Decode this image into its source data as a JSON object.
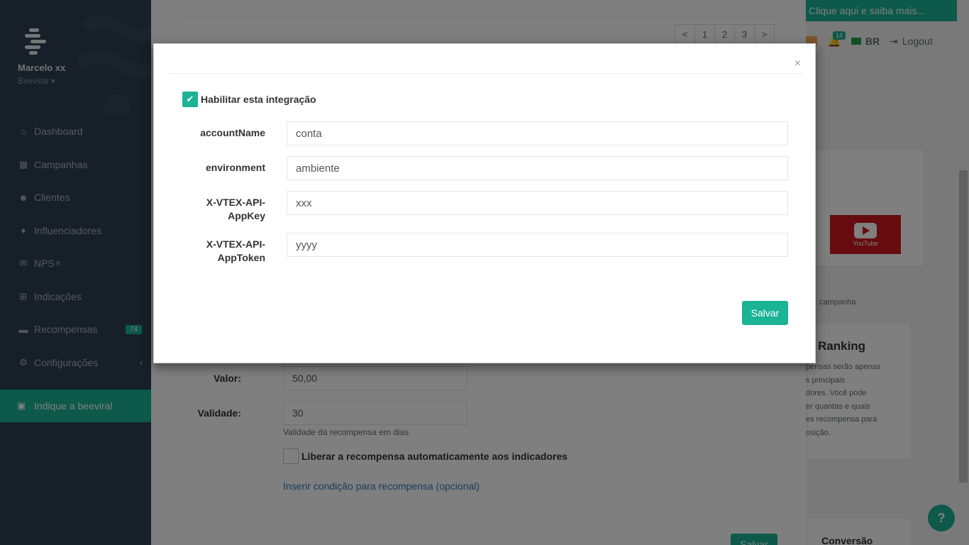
{
  "user": {
    "name": "Marcelo xx",
    "company": "Beeviral"
  },
  "sidebar": {
    "items": [
      {
        "label": "Dashboard",
        "icon": "home-icon"
      },
      {
        "label": "Campanhas",
        "icon": "grid-icon"
      },
      {
        "label": "Clientes",
        "icon": "users-icon"
      },
      {
        "label": "Influenciadores",
        "icon": "diamond-icon"
      },
      {
        "label": "NPS",
        "sup": "®",
        "icon": "envelope-icon"
      },
      {
        "label": "Indicações",
        "icon": "sitemap-icon"
      },
      {
        "label": "Recompensas",
        "badge": "74",
        "icon": "money-icon"
      },
      {
        "label": "Configurações",
        "icon": "cogs-icon"
      }
    ],
    "cta": "Indique a beeviral"
  },
  "topbar": {
    "promo": "Clique aqui e saiba mais...",
    "notifications_count": "14",
    "language": "BR",
    "logout": "Logout"
  },
  "background_page": {
    "pagination": [
      "<",
      "1",
      "2",
      "3",
      ">"
    ],
    "valor_label": "Valor:",
    "valor_value": "50,00",
    "validade_label": "Validade:",
    "validade_value": "30",
    "validade_help": "Validade da recompensa em dias",
    "auto_release_label": "Liberar a recompensa automaticamente aos indicadores",
    "condition_link": "Inserir condição para recompensa (opcional)",
    "save": "Salvar"
  },
  "right_panel": {
    "youtube_text": "YouTube",
    "campaign_text": "campanha.",
    "ranking_title": "Ranking",
    "ranking_lines": [
      "pensas serão apenas",
      "s principais",
      "dores. Você pode",
      "er quantas e quais",
      "es recompensa para",
      "osição."
    ],
    "conversion_title": "Conversão"
  },
  "modal": {
    "close": "×",
    "enable_label": "Habilitar esta integração",
    "enabled": true,
    "fields": [
      {
        "label": "accountName",
        "value": "conta"
      },
      {
        "label": "environment",
        "value": "ambiente"
      },
      {
        "label": "X-VTEX-API-AppKey",
        "value": "xxx"
      },
      {
        "label": "X-VTEX-API-AppToken",
        "value": "yyyy"
      }
    ],
    "save": "Salvar"
  },
  "help_button": "?",
  "colors": {
    "accent": "#1ab394",
    "sidebar": "#2f4050",
    "overlay": "rgba(0,0,0,0.5)"
  }
}
